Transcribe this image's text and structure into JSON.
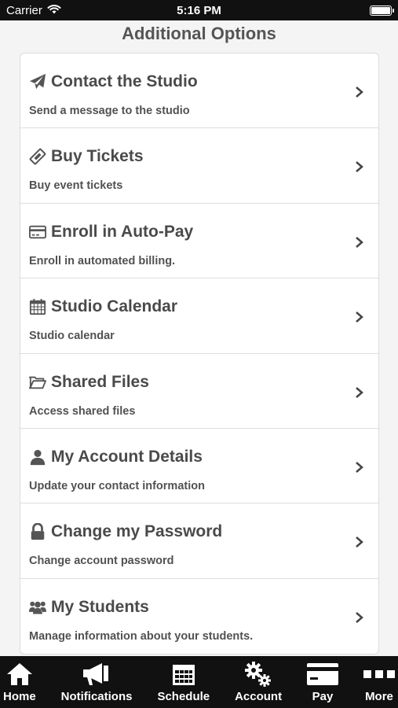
{
  "status": {
    "carrier": "Carrier",
    "time": "5:16 PM"
  },
  "header": {
    "title": "Additional Options"
  },
  "items": [
    {
      "icon": "paper-plane-icon",
      "title": "Contact the Studio",
      "subtitle": "Send a message to the studio"
    },
    {
      "icon": "ticket-icon",
      "title": "Buy Tickets",
      "subtitle": "Buy event tickets"
    },
    {
      "icon": "credit-card-icon",
      "title": "Enroll in Auto-Pay",
      "subtitle": "Enroll in automated billing."
    },
    {
      "icon": "calendar-icon",
      "title": "Studio Calendar",
      "subtitle": "Studio calendar"
    },
    {
      "icon": "folder-open-icon",
      "title": "Shared Files",
      "subtitle": "Access shared files"
    },
    {
      "icon": "user-icon",
      "title": "My Account Details",
      "subtitle": "Update your contact information"
    },
    {
      "icon": "lock-icon",
      "title": "Change my Password",
      "subtitle": "Change account password"
    },
    {
      "icon": "users-icon",
      "title": "My Students",
      "subtitle": "Manage information about your students."
    }
  ],
  "tabs": [
    {
      "icon": "home-icon",
      "label": "Home"
    },
    {
      "icon": "megaphone-icon",
      "label": "Notifications"
    },
    {
      "icon": "calendar-icon",
      "label": "Schedule"
    },
    {
      "icon": "gears-icon",
      "label": "Account"
    },
    {
      "icon": "credit-card-icon",
      "label": "Pay"
    },
    {
      "icon": "more-icon",
      "label": "More"
    }
  ]
}
